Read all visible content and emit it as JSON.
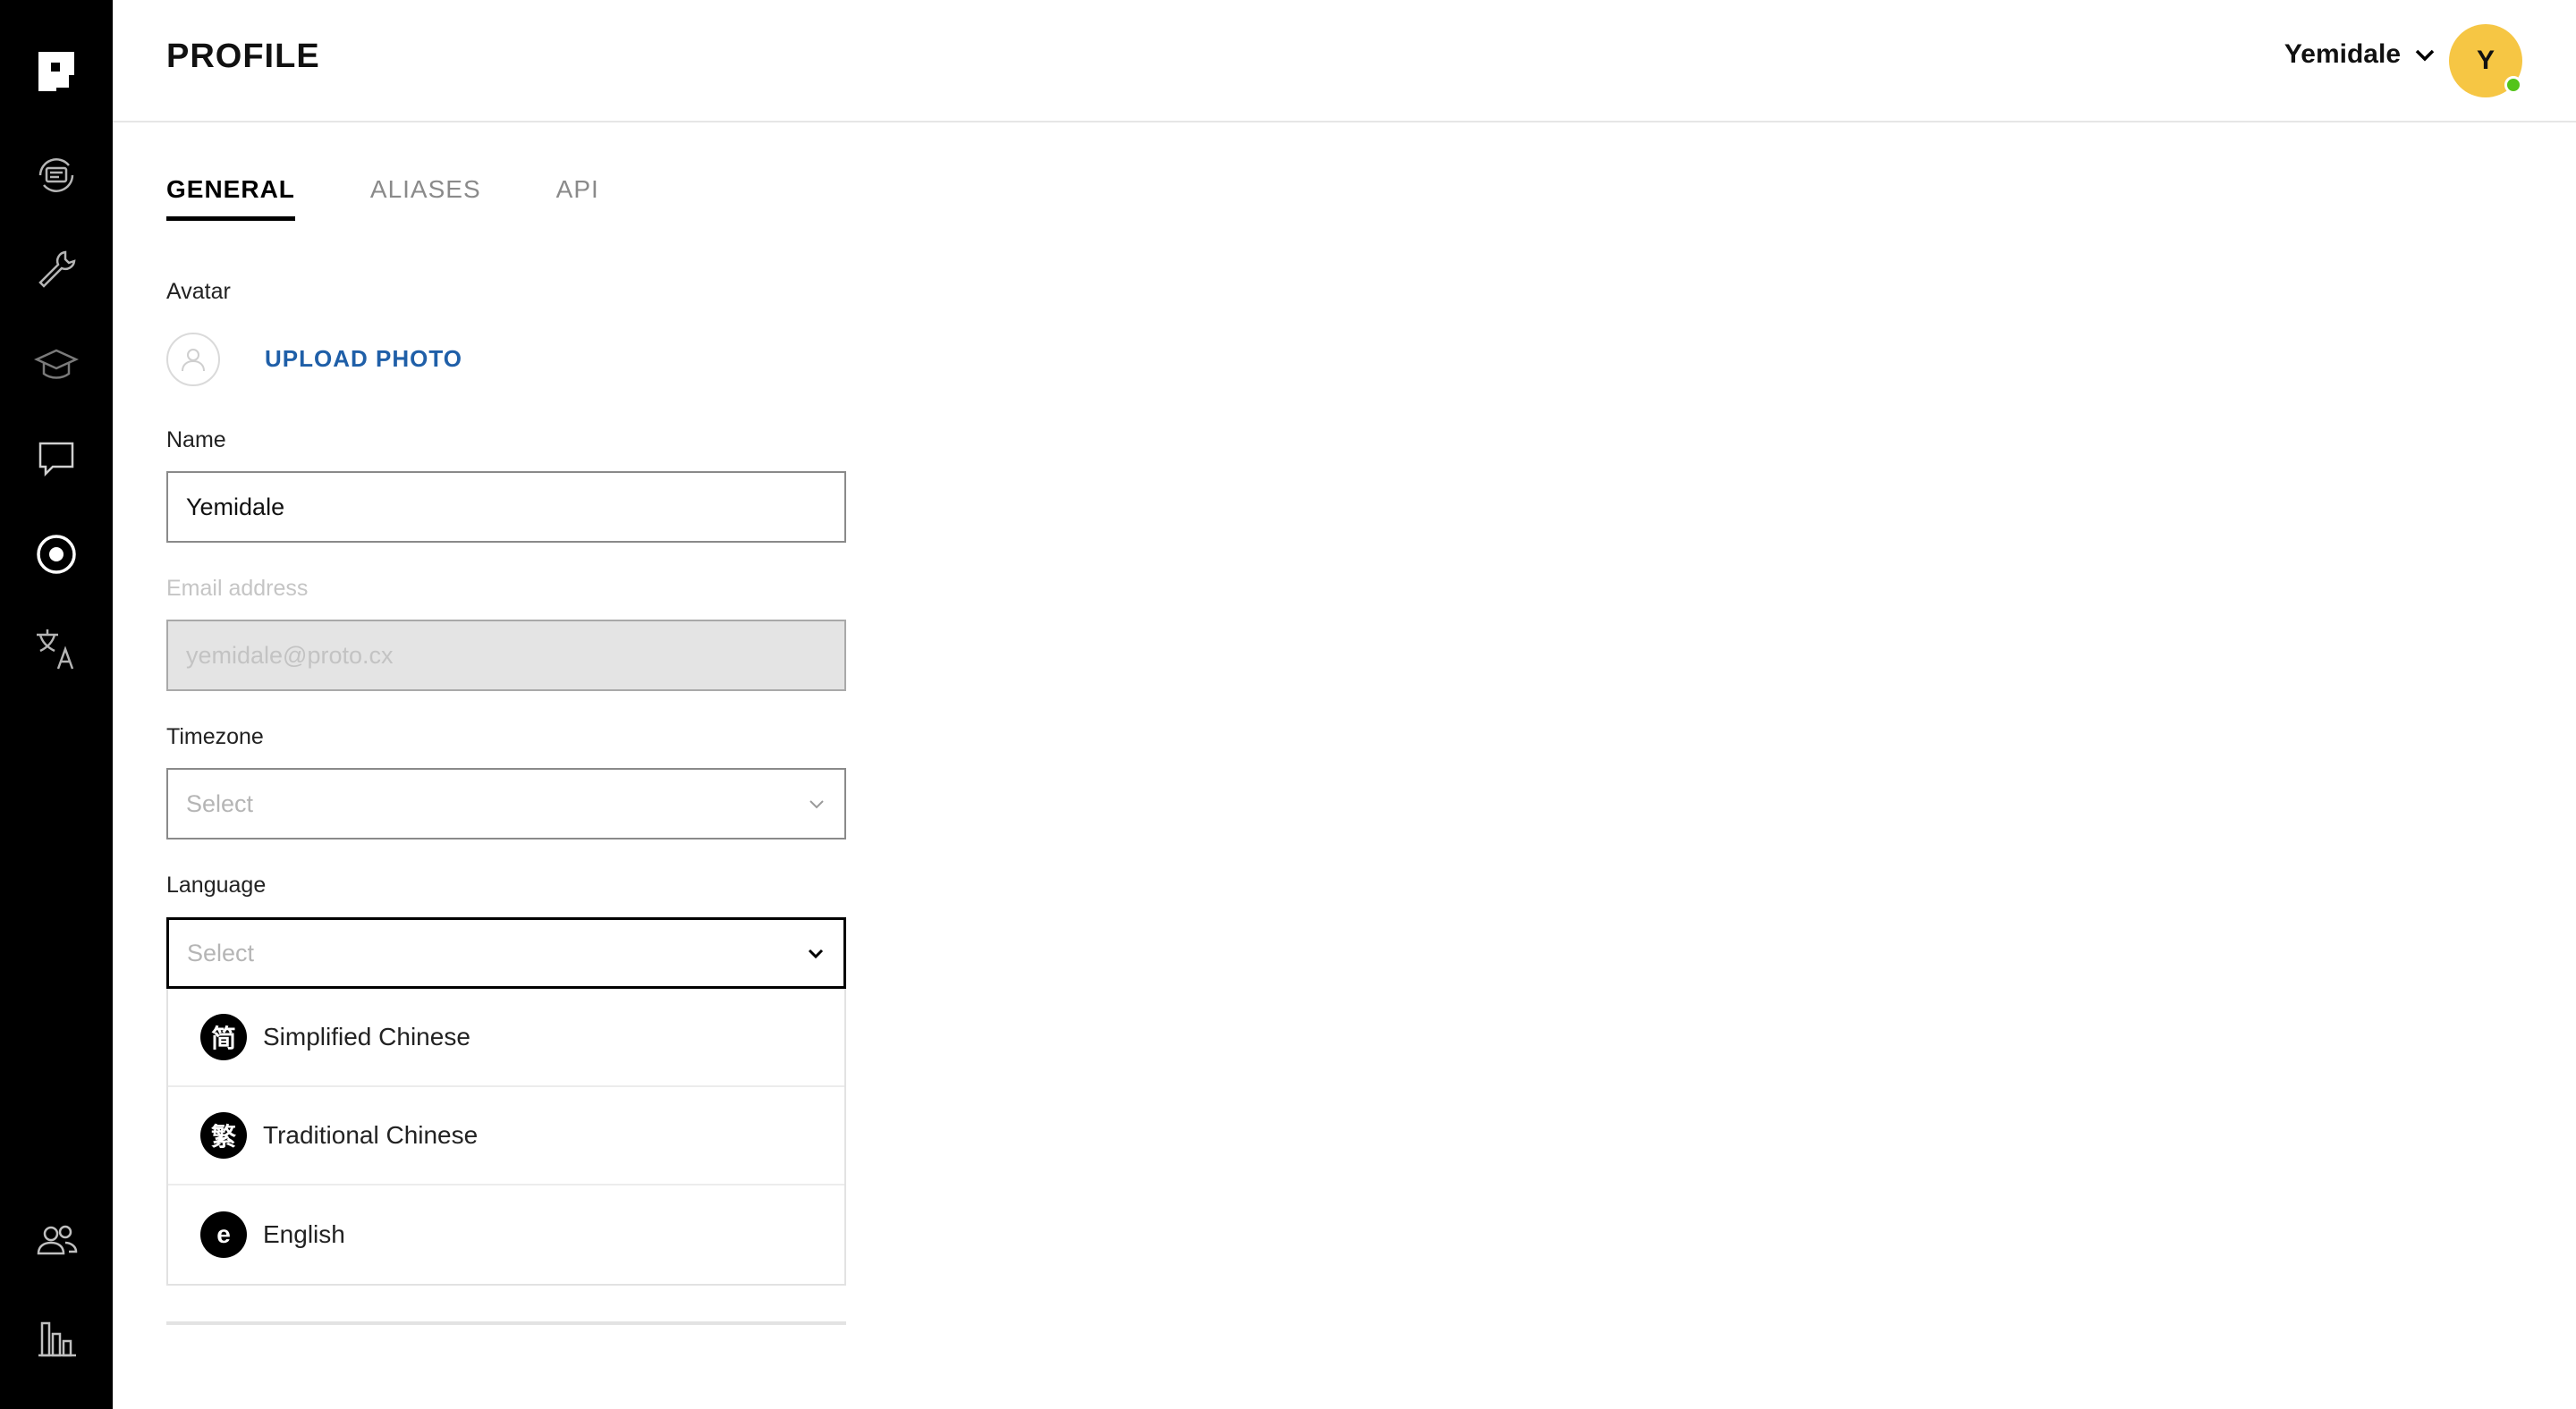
{
  "sidebar": {
    "items": [
      {
        "icon": "logo-icon"
      },
      {
        "icon": "conversation-flow-icon"
      },
      {
        "icon": "wrench-icon"
      },
      {
        "icon": "graduation-cap-icon"
      },
      {
        "icon": "chat-bubble-icon"
      },
      {
        "icon": "target-icon"
      },
      {
        "icon": "translate-icon"
      },
      {
        "icon": "users-icon"
      },
      {
        "icon": "analytics-chart-icon"
      }
    ]
  },
  "header": {
    "title": "PROFILE",
    "user_name": "Yemidale",
    "avatar_initial": "Y",
    "status": "online"
  },
  "tabs": [
    {
      "label": "GENERAL",
      "active": true
    },
    {
      "label": "ALIASES",
      "active": false
    },
    {
      "label": "API",
      "active": false
    }
  ],
  "form": {
    "avatar_label": "Avatar",
    "upload_label": "UPLOAD PHOTO",
    "name_label": "Name",
    "name_value": "Yemidale",
    "email_label": "Email address",
    "email_value": "yemidale@proto.cx",
    "timezone_label": "Timezone",
    "timezone_placeholder": "Select",
    "language_label": "Language",
    "language_placeholder": "Select"
  },
  "language_options": [
    {
      "badge": "简",
      "label": "Simplified Chinese"
    },
    {
      "badge": "繁",
      "label": "Traditional Chinese"
    },
    {
      "badge": "e",
      "label": "English"
    }
  ],
  "colors": {
    "sidebar_bg": "#000000",
    "accent_link": "#1f5fa8",
    "avatar_bg": "#f6c644",
    "online_status": "#53c41a"
  }
}
